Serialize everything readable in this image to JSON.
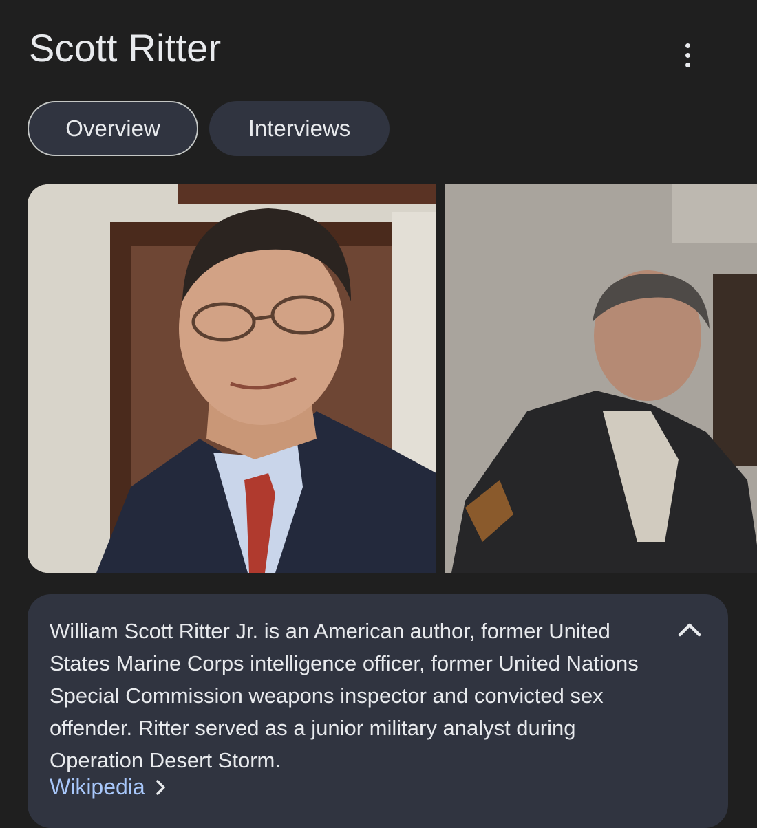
{
  "header": {
    "title": "Scott Ritter",
    "menu_icon": "more-vert-icon"
  },
  "tabs": [
    {
      "label": "Overview",
      "active": true
    },
    {
      "label": "Interviews",
      "active": false
    }
  ],
  "images": [
    {
      "alt": "Scott Ritter in suit and glasses"
    },
    {
      "alt": "Scott Ritter walking beside an officer"
    }
  ],
  "summary": {
    "text": "William Scott Ritter Jr. is an American author, former United States Marine Corps intelligence officer, former United Nations Special Commission weapons inspector and convicted sex offender. Ritter served as a junior military analyst during Operation Desert Storm.",
    "source": "Wikipedia",
    "collapse_icon": "chevron-up-icon",
    "source_icon": "chevron-right-icon"
  },
  "colors": {
    "background": "#1f1f1f",
    "card": "#303440",
    "link": "#a8c7fa",
    "text": "#e8eaed"
  }
}
